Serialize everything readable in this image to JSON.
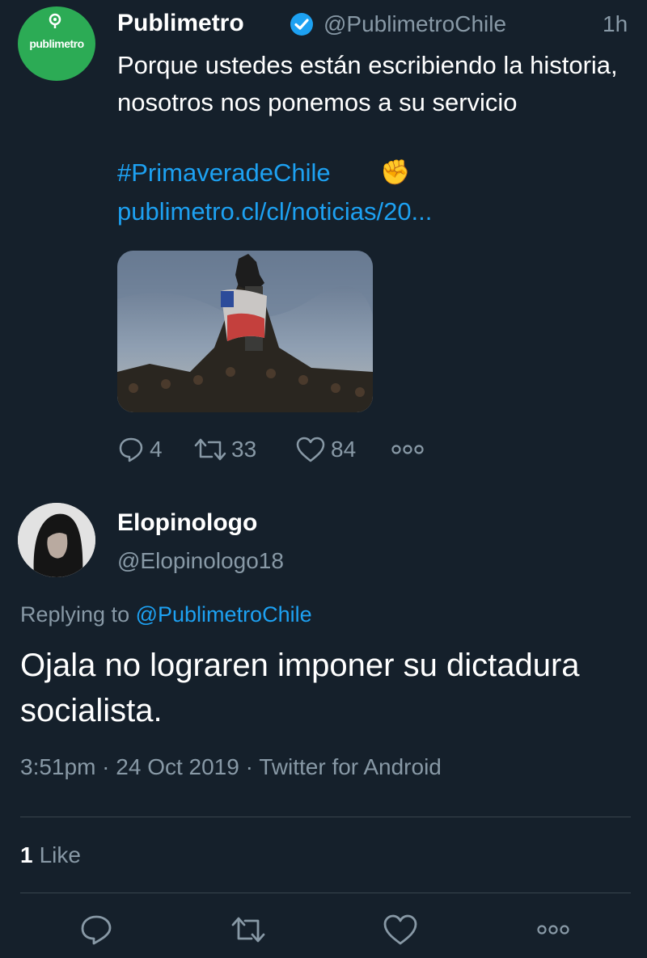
{
  "tweet": {
    "avatar_text": "publimetro",
    "author_name": "Publimetro",
    "author_handle": "@PublimetroChile",
    "time": "1h",
    "text": "Porque ustedes están escribiendo la historia, nosotros nos ponemos a su servicio",
    "hashtag": "#PrimaveradeChile",
    "emoji": "✊",
    "link": "publimetro.cl/cl/noticias/20...",
    "replies": "4",
    "retweets": "33",
    "likes": "84"
  },
  "reply": {
    "author_name": "Elopinologo",
    "author_handle": "@Elopinologo18",
    "replying_label": "Replying to",
    "replying_to": "@PublimetroChile",
    "text": "Ojala no lograren imponer su dictadura socialista.",
    "meta": "3:51pm · 24 Oct 2019 · Twitter for Android",
    "like_count": "1",
    "like_label": "Like"
  },
  "colors": {
    "background": "#15202b",
    "secondary_text": "#8899a6",
    "accent": "#1da1f2",
    "divider": "#38444d",
    "avatar_green": "#2cab55"
  },
  "icons": [
    "verified-badge-icon",
    "reply-icon",
    "retweet-icon",
    "like-icon",
    "more-icon"
  ]
}
